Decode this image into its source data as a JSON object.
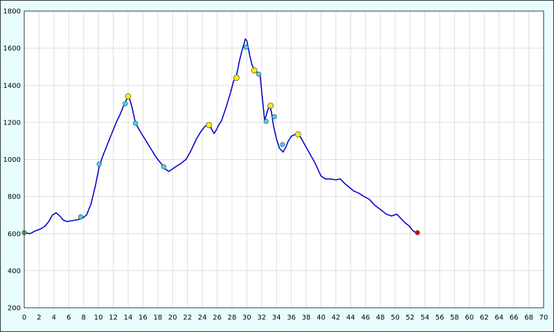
{
  "colors": {
    "background": "#e8fdfd",
    "plot_background": "#ffffff",
    "grid": "#dddddd",
    "line": "#0000cc",
    "marker_start": "#33cc33",
    "marker_end": "#dd0000",
    "marker_cyan": "#33ddee",
    "marker_yellow": "#ffee00"
  },
  "chart_data": {
    "type": "line",
    "title": "",
    "xlabel": "",
    "ylabel": "",
    "xlim": [
      0,
      70
    ],
    "ylim": [
      200,
      1800
    ],
    "grid": true,
    "x_ticks": [
      0,
      2,
      4,
      6,
      8,
      10,
      12,
      14,
      16,
      18,
      20,
      22,
      24,
      26,
      28,
      30,
      32,
      34,
      36,
      38,
      40,
      42,
      44,
      46,
      48,
      50,
      52,
      54,
      56,
      58,
      60,
      62,
      64,
      66,
      68,
      70
    ],
    "y_ticks": [
      200,
      400,
      600,
      800,
      1000,
      1200,
      1400,
      1600,
      1800
    ],
    "series": [
      {
        "x": [
          0,
          0.8,
          1.5,
          2.2,
          2.8,
          3.3,
          3.8,
          4.3,
          4.8,
          5.2,
          5.7,
          6.5,
          7.2,
          7.8,
          8.4,
          9.0,
          9.6,
          10.1,
          10.6,
          11.2,
          11.8,
          12.4,
          12.9,
          13.4,
          13.8,
          14.1,
          14.5,
          15.0,
          15.8,
          16.8,
          17.8,
          18.6,
          19.1,
          19.5,
          20.2,
          21.0,
          21.8,
          22.5,
          23.2,
          23.8,
          24.4,
          25.0,
          25.3,
          25.6,
          25.9,
          26.2,
          26.6,
          27.2,
          27.8,
          28.2,
          28.6,
          29.0,
          29.3,
          29.6,
          29.8,
          30.0,
          30.2,
          30.4,
          30.7,
          31.0,
          31.4,
          31.8,
          32.1,
          32.4,
          32.7,
          33.0,
          33.3,
          33.6,
          34.0,
          34.4,
          34.9,
          35.3,
          35.6,
          36.0,
          36.5,
          37.1,
          37.8,
          38.5,
          39.2,
          40.0,
          40.6,
          41.2,
          42.0,
          42.6,
          43.2,
          43.8,
          44.4,
          45.0,
          45.8,
          46.5,
          47.2,
          48.0,
          48.8,
          49.5,
          50.2,
          50.8,
          51.3,
          51.9,
          52.4,
          52.8,
          53.0
        ],
        "y": [
          605,
          600,
          615,
          625,
          640,
          665,
          700,
          712,
          695,
          675,
          665,
          670,
          675,
          682,
          700,
          760,
          860,
          960,
          1020,
          1080,
          1140,
          1200,
          1240,
          1290,
          1325,
          1340,
          1285,
          1195,
          1140,
          1075,
          1010,
          970,
          945,
          935,
          955,
          975,
          1000,
          1050,
          1110,
          1150,
          1180,
          1185,
          1160,
          1140,
          1160,
          1185,
          1210,
          1280,
          1360,
          1420,
          1450,
          1530,
          1580,
          1620,
          1650,
          1640,
          1600,
          1560,
          1510,
          1485,
          1470,
          1450,
          1330,
          1210,
          1250,
          1290,
          1260,
          1180,
          1110,
          1060,
          1040,
          1070,
          1100,
          1125,
          1135,
          1130,
          1080,
          1030,
          980,
          910,
          895,
          895,
          890,
          895,
          870,
          850,
          830,
          820,
          800,
          785,
          755,
          730,
          705,
          695,
          705,
          680,
          660,
          640,
          615,
          605,
          605
        ]
      }
    ],
    "markers": [
      {
        "x": 0,
        "y": 605,
        "kind": "start"
      },
      {
        "x": 7.6,
        "y": 690,
        "kind": "cyan"
      },
      {
        "x": 10.1,
        "y": 975,
        "kind": "cyan"
      },
      {
        "x": 13.6,
        "y": 1300,
        "kind": "cyan"
      },
      {
        "x": 14.0,
        "y": 1340,
        "kind": "yellow"
      },
      {
        "x": 15.0,
        "y": 1195,
        "kind": "cyan"
      },
      {
        "x": 18.8,
        "y": 960,
        "kind": "cyan"
      },
      {
        "x": 24.9,
        "y": 1185,
        "kind": "yellow"
      },
      {
        "x": 28.6,
        "y": 1440,
        "kind": "yellow"
      },
      {
        "x": 29.9,
        "y": 1605,
        "kind": "cyan"
      },
      {
        "x": 31.0,
        "y": 1480,
        "kind": "yellow"
      },
      {
        "x": 31.6,
        "y": 1460,
        "kind": "cyan"
      },
      {
        "x": 32.6,
        "y": 1205,
        "kind": "cyan"
      },
      {
        "x": 33.2,
        "y": 1290,
        "kind": "yellow"
      },
      {
        "x": 33.7,
        "y": 1230,
        "kind": "cyan"
      },
      {
        "x": 34.8,
        "y": 1080,
        "kind": "cyan"
      },
      {
        "x": 36.9,
        "y": 1135,
        "kind": "yellow"
      },
      {
        "x": 53.0,
        "y": 605,
        "kind": "end"
      }
    ]
  }
}
